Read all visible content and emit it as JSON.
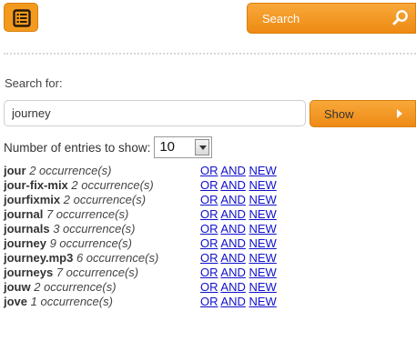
{
  "header": {
    "menu_icon": "list-icon",
    "search_button_label": "Search",
    "search_icon": "magnifier-icon",
    "accent_color": "#f39a1e"
  },
  "search_form": {
    "search_for_label": "Search for:",
    "query_value": "journey",
    "show_button_label": "Show",
    "show_arrow_icon": "arrow-right-icon"
  },
  "entries": {
    "label": "Number of entries to show:",
    "selected_value": "10"
  },
  "results": [
    {
      "term": "jour",
      "count": "2 occurrence(s)"
    },
    {
      "term": "jour-fix-mix",
      "count": "2 occurrence(s)"
    },
    {
      "term": "jourfixmix",
      "count": "2 occurrence(s)"
    },
    {
      "term": "journal",
      "count": "7 occurrence(s)"
    },
    {
      "term": "journals",
      "count": "3 occurrence(s)"
    },
    {
      "term": "journey",
      "count": "9 occurrence(s)"
    },
    {
      "term": "journey.mp3",
      "count": "6 occurrence(s)"
    },
    {
      "term": "journeys",
      "count": "7 occurrence(s)"
    },
    {
      "term": "jouw",
      "count": "2 occurrence(s)"
    },
    {
      "term": "jove",
      "count": "1 occurrence(s)"
    }
  ],
  "link_labels": {
    "or": "OR",
    "and": "AND",
    "new": "NEW"
  }
}
